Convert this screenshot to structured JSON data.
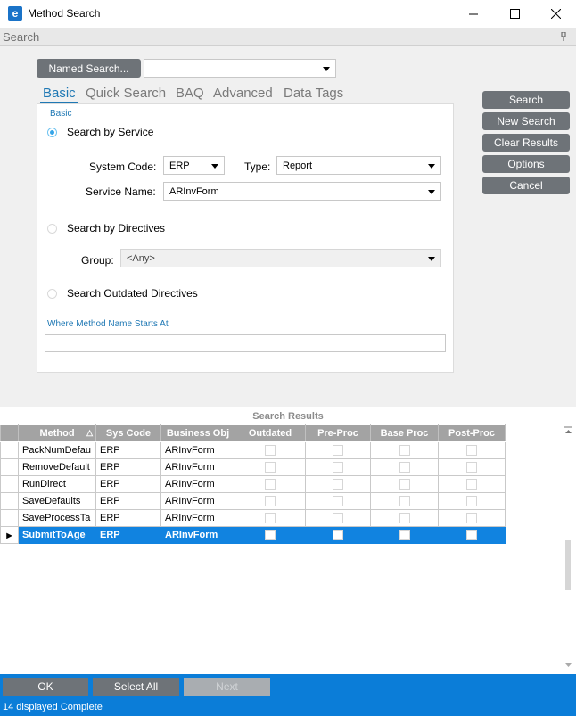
{
  "window": {
    "title": "Method Search",
    "app_icon": "e"
  },
  "search_bar": {
    "label": "Search"
  },
  "named_search": {
    "button_label": "Named Search...",
    "value": ""
  },
  "tabs": [
    {
      "label": "Basic",
      "active": true
    },
    {
      "label": "Quick Search"
    },
    {
      "label": "BAQ"
    },
    {
      "label": "Advanced"
    },
    {
      "label": "Data Tags"
    }
  ],
  "basic": {
    "group_label": "Basic",
    "search_by_service": {
      "label": "Search by Service",
      "selected": true,
      "system_code_label": "System Code:",
      "system_code_value": "ERP",
      "type_label": "Type:",
      "type_value": "Report",
      "service_name_label": "Service Name:",
      "service_name_value": "ARInvForm"
    },
    "search_by_directives": {
      "label": "Search by Directives",
      "group_label": "Group:",
      "group_value": "<Any>"
    },
    "search_outdated": {
      "label": "Search Outdated Directives"
    },
    "method_starts_label": "Where Method Name Starts At",
    "method_starts_value": ""
  },
  "actions": {
    "search": "Search",
    "new_search": "New Search",
    "clear_results": "Clear Results",
    "options": "Options",
    "cancel": "Cancel"
  },
  "results": {
    "title": "Search Results",
    "columns": [
      "Method",
      "Sys Code",
      "Business Obj",
      "Outdated",
      "Pre-Proc",
      "Base Proc",
      "Post-Proc"
    ],
    "rows": [
      {
        "method": "PackNumDefau",
        "sys_code": "ERP",
        "business_obj": "ARInvForm"
      },
      {
        "method": "RemoveDefault",
        "sys_code": "ERP",
        "business_obj": "ARInvForm"
      },
      {
        "method": "RunDirect",
        "sys_code": "ERP",
        "business_obj": "ARInvForm"
      },
      {
        "method": "SaveDefaults",
        "sys_code": "ERP",
        "business_obj": "ARInvForm"
      },
      {
        "method": "SaveProcessTa",
        "sys_code": "ERP",
        "business_obj": "ARInvForm"
      },
      {
        "method": "SubmitToAge",
        "sys_code": "ERP",
        "business_obj": "ARInvForm",
        "selected": true
      }
    ]
  },
  "footer": {
    "ok": "OK",
    "select_all": "Select All",
    "next": "Next",
    "status": "14 displayed Complete"
  }
}
